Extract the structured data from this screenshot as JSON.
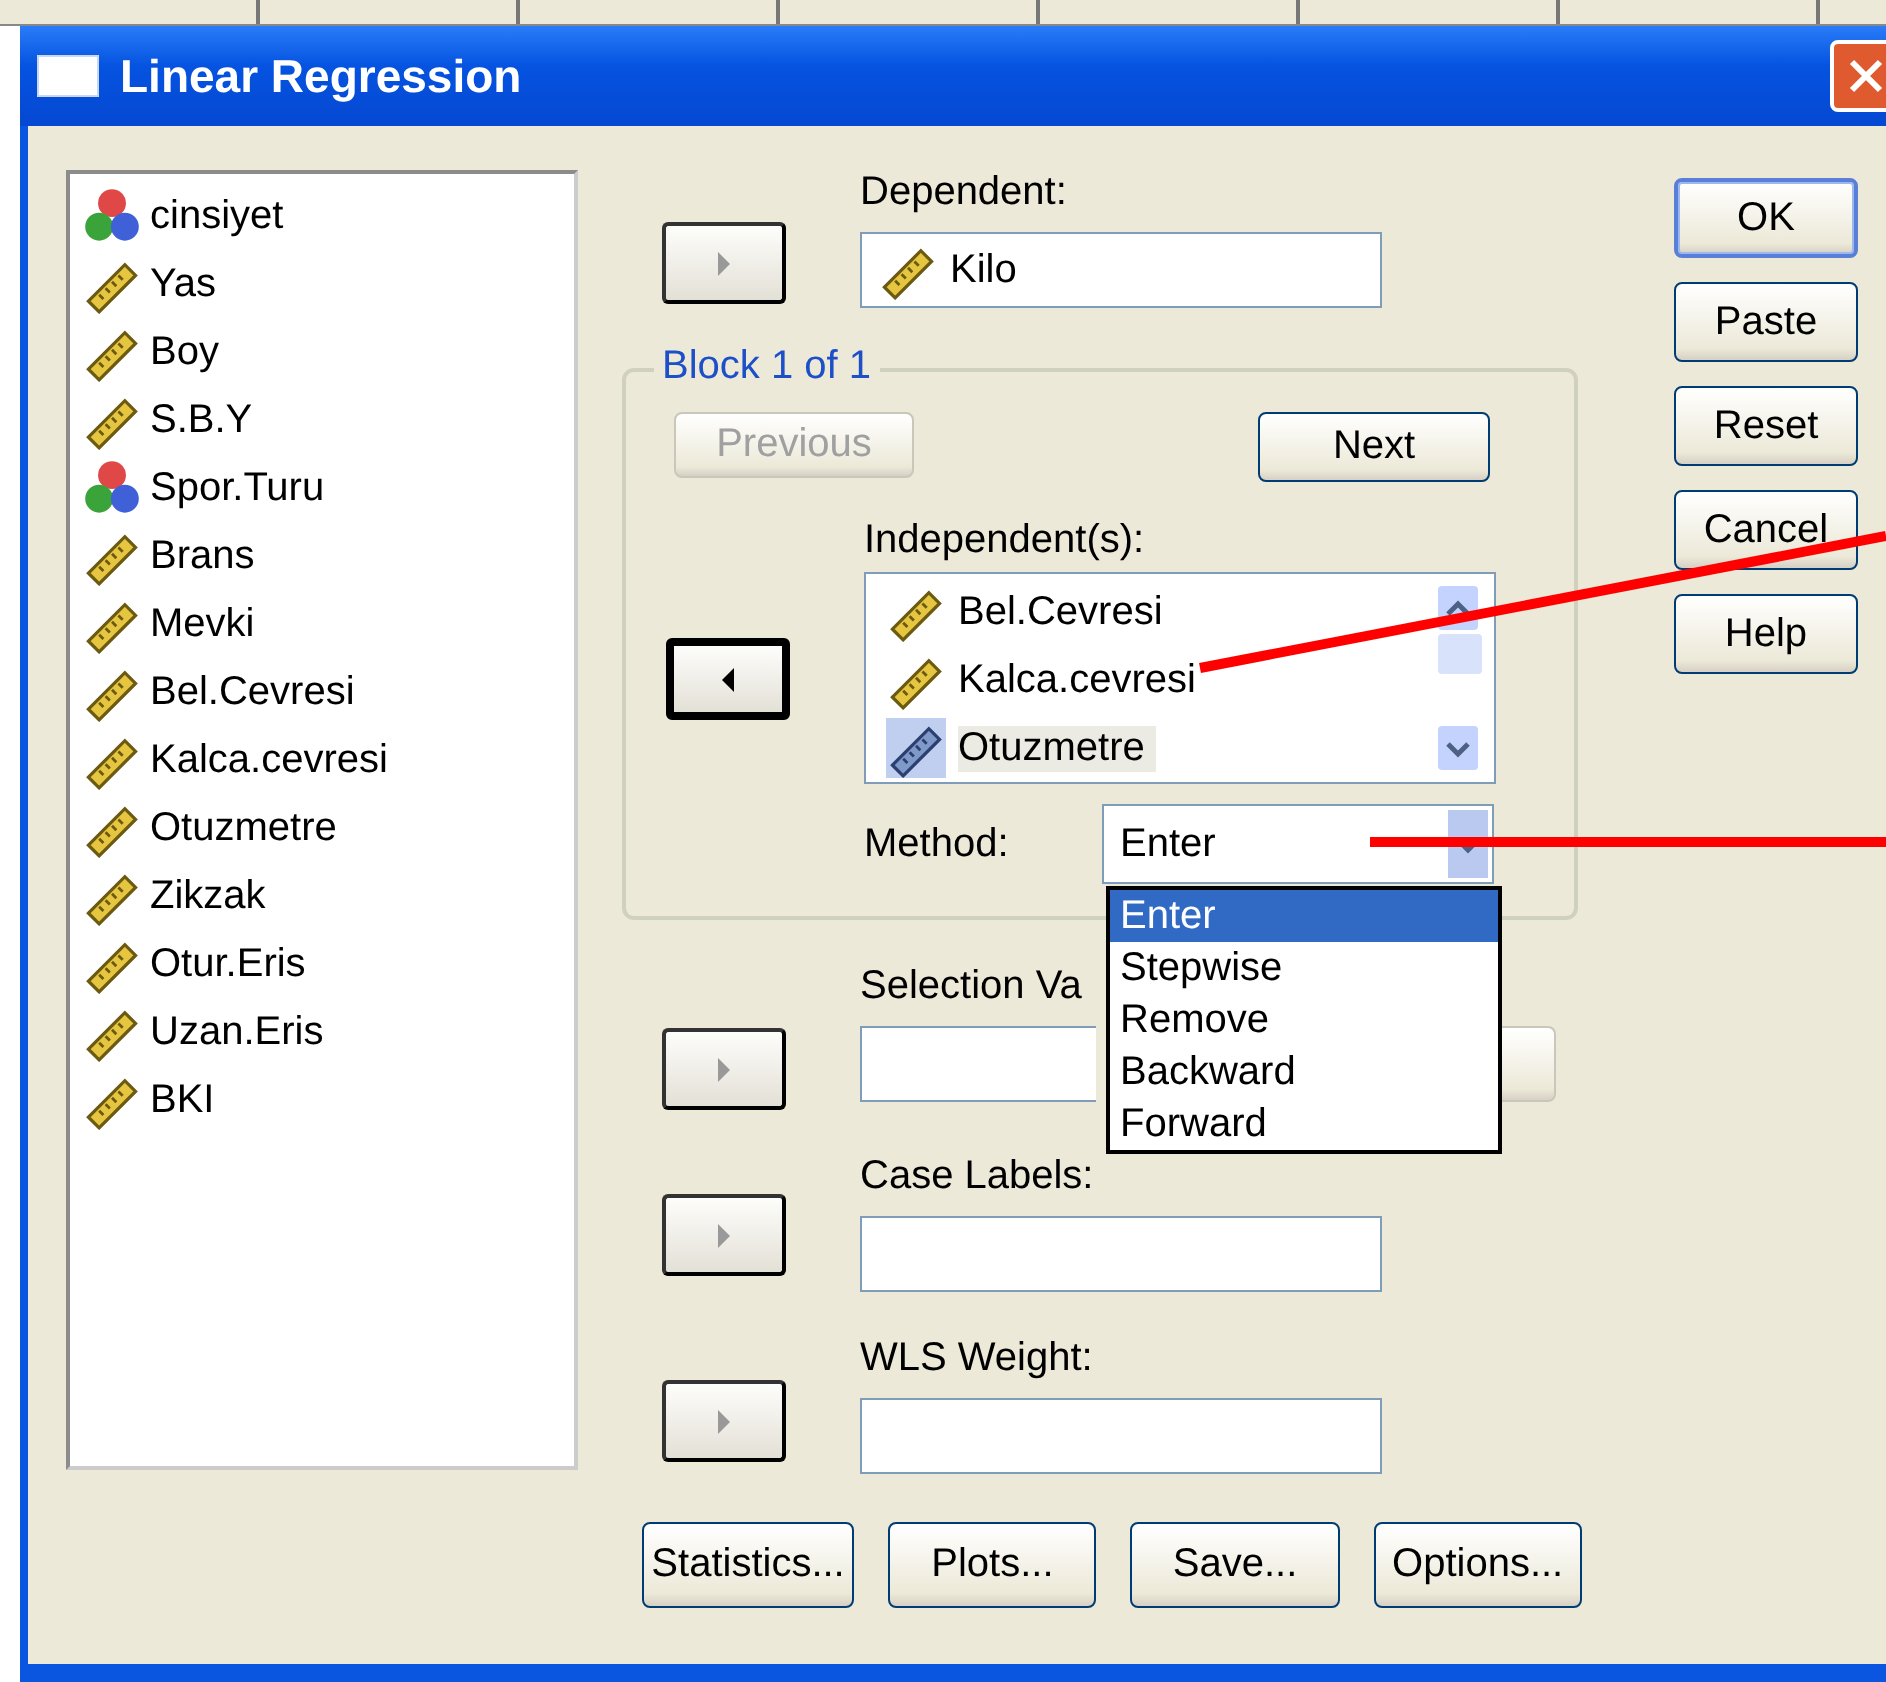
{
  "window": {
    "title": "Linear Regression"
  },
  "variables": [
    {
      "name": "cinsiyet",
      "kind": "nominal"
    },
    {
      "name": "Yas",
      "kind": "scale"
    },
    {
      "name": "Boy",
      "kind": "scale"
    },
    {
      "name": "S.B.Y",
      "kind": "scale"
    },
    {
      "name": "Spor.Turu",
      "kind": "nominal"
    },
    {
      "name": "Brans",
      "kind": "scale"
    },
    {
      "name": "Mevki",
      "kind": "scale"
    },
    {
      "name": "Bel.Cevresi",
      "kind": "scale"
    },
    {
      "name": "Kalca.cevresi",
      "kind": "scale"
    },
    {
      "name": "Otuzmetre",
      "kind": "scale"
    },
    {
      "name": "Zikzak",
      "kind": "scale"
    },
    {
      "name": "Otur.Eris",
      "kind": "scale"
    },
    {
      "name": "Uzan.Eris",
      "kind": "scale"
    },
    {
      "name": "BKI",
      "kind": "scale"
    }
  ],
  "dependent": {
    "label": "Dependent:",
    "value": {
      "name": "Kilo",
      "kind": "scale"
    }
  },
  "block": {
    "title": "Block 1 of 1",
    "previous": {
      "label": "Previous",
      "disabled": true
    },
    "next": {
      "label": "Next",
      "disabled": false
    },
    "independents_label": "Independent(s):",
    "independents": [
      {
        "name": "Bel.Cevresi",
        "kind": "scale",
        "selected": false
      },
      {
        "name": "Kalca.cevresi",
        "kind": "scale",
        "selected": false
      },
      {
        "name": "Otuzmetre",
        "kind": "scale",
        "selected": true
      }
    ],
    "method_label": "Method:",
    "method": "Enter",
    "method_options": [
      {
        "label": "Enter",
        "selected": true
      },
      {
        "label": "Stepwise",
        "selected": false
      },
      {
        "label": "Remove",
        "selected": false
      },
      {
        "label": "Backward",
        "selected": false
      },
      {
        "label": "Forward",
        "selected": false
      }
    ]
  },
  "selection": {
    "label": "Selection Va"
  },
  "case_labels": {
    "label": "Case Labels:"
  },
  "wls_weight": {
    "label": "WLS Weight:"
  },
  "arrow_buttons": [
    {
      "kind": "right",
      "focused": false
    },
    {
      "kind": "left",
      "focused": true
    },
    {
      "kind": "right",
      "focused": false
    },
    {
      "kind": "right",
      "focused": false
    },
    {
      "kind": "right",
      "focused": false
    }
  ],
  "side_buttons": [
    {
      "label": "OK",
      "default": true
    },
    {
      "label": "Paste",
      "default": false
    },
    {
      "label": "Reset",
      "default": false
    },
    {
      "label": "Cancel",
      "default": false
    },
    {
      "label": "Help",
      "default": false
    }
  ],
  "bottom_buttons": [
    "Statistics...",
    "Plots...",
    "Save...",
    "Options..."
  ]
}
